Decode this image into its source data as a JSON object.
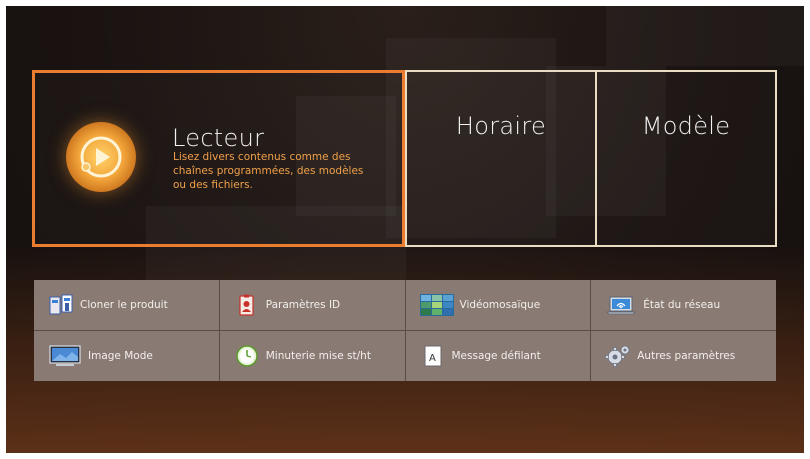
{
  "tiles": {
    "player": {
      "title": "Lecteur",
      "description": "Lisez divers contenus comme des chaînes programmées, des modèles ou des fichiers."
    },
    "schedule": {
      "title": "Horaire"
    },
    "template": {
      "title": "Modèle"
    }
  },
  "menu": {
    "clone_product": "Cloner le produit",
    "id_settings": "Paramètres ID",
    "video_wall": "Vidéomosaïque",
    "network_status": "État du réseau",
    "image_mode": "Image Mode",
    "on_off_timer": "Minuterie mise st/ht",
    "ticker": "Message défilant",
    "more_settings": "Autres paramètres"
  },
  "colors": {
    "accent": "#ea7d2f",
    "tile_border": "#e9dcc2",
    "description_text": "#f0a04a",
    "menu_background": "#8a7a74"
  },
  "icons": {
    "player": "play-icon",
    "clone_product": "clone-icon",
    "id_settings": "id-badge-icon",
    "video_wall": "video-wall-icon",
    "network_status": "network-laptop-icon",
    "image_mode": "monitor-icon",
    "on_off_timer": "timer-icon",
    "ticker": "ticker-icon",
    "more_settings": "gears-icon"
  }
}
